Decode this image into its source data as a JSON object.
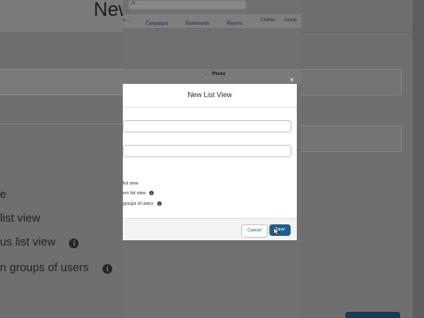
{
  "background": {
    "title_fragment": "New",
    "options": [
      {
        "text": "list view",
        "info": false
      },
      {
        "text": "us list view",
        "info": true
      },
      {
        "text": "n groups of users",
        "info": true
      }
    ]
  },
  "nav": {
    "search_text": "ch...",
    "items": [
      {
        "label": "Campaigns",
        "chevron": true
      },
      {
        "label": "Dashboards",
        "chevron": true
      },
      {
        "label": "Reports",
        "chevron": true
      },
      {
        "label": "Chatter",
        "chevron": false
      },
      {
        "label": "Group",
        "chevron": false
      }
    ]
  },
  "table": {
    "column": "Phone"
  },
  "modal": {
    "title": "New List View",
    "close_symbol": "×",
    "radio_options": [
      {
        "text": "list view",
        "info": false
      },
      {
        "text": "ers list view",
        "info": true
      },
      {
        "text": "groups of users",
        "info": true
      }
    ],
    "cancel_label": "Cancel",
    "save_label": "Save"
  },
  "colors": {
    "save_button": "#1b5f8f",
    "link": "#0b5cab"
  }
}
